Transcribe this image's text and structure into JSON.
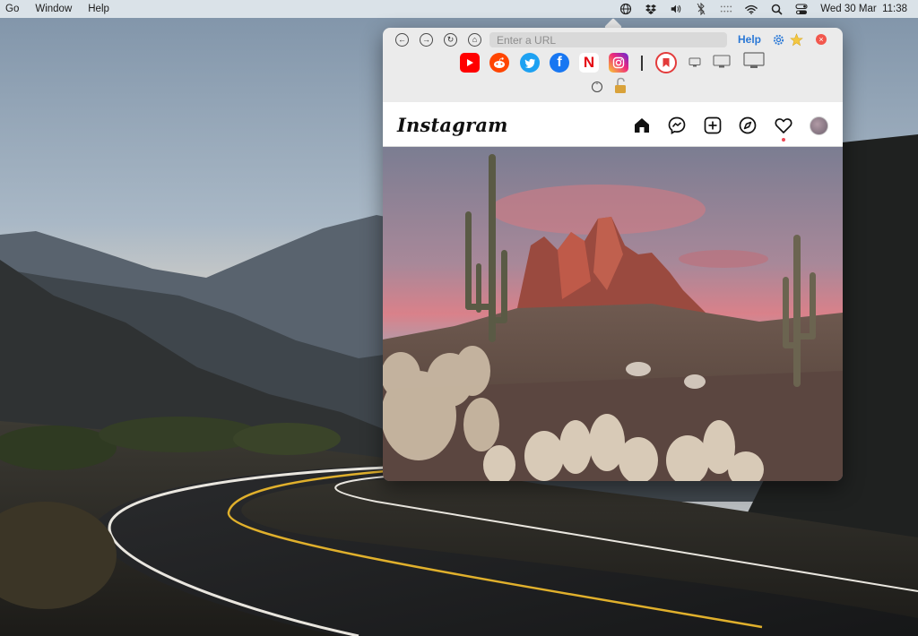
{
  "menubar": {
    "menus": [
      "Go",
      "Window",
      "Help"
    ],
    "clock": "Wed 30 Mar  11:38"
  },
  "toolbar": {
    "url_placeholder": "Enter a URL",
    "help_label": "Help",
    "favorites": [
      {
        "name": "YouTube",
        "icon": "youtube-icon",
        "color": "#ff0000"
      },
      {
        "name": "Reddit",
        "icon": "reddit-icon",
        "color": "#ff4500"
      },
      {
        "name": "Twitter",
        "icon": "twitter-icon",
        "color": "#1da1f2"
      },
      {
        "name": "Facebook",
        "icon": "facebook-icon",
        "color": "#1877f2"
      },
      {
        "name": "Netflix",
        "icon": "netflix-icon",
        "color": "#e50914"
      },
      {
        "name": "Instagram",
        "icon": "instagram-icon",
        "color": "#d6249f"
      },
      {
        "name": "Bookmark",
        "icon": "bookmark-icon",
        "color": "#e33b3b"
      }
    ],
    "devices": [
      "phone-size-icon",
      "tablet-size-icon",
      "desktop-size-icon"
    ]
  },
  "instagram": {
    "logo": "Instagram",
    "nav_icons": [
      "home-icon",
      "messenger-icon",
      "new-post-icon",
      "explore-icon",
      "activity-heart-icon",
      "profile-avatar"
    ]
  },
  "colors": {
    "accent": "#2a78d6",
    "close": "#f2574d",
    "notification": "#ed4956"
  }
}
